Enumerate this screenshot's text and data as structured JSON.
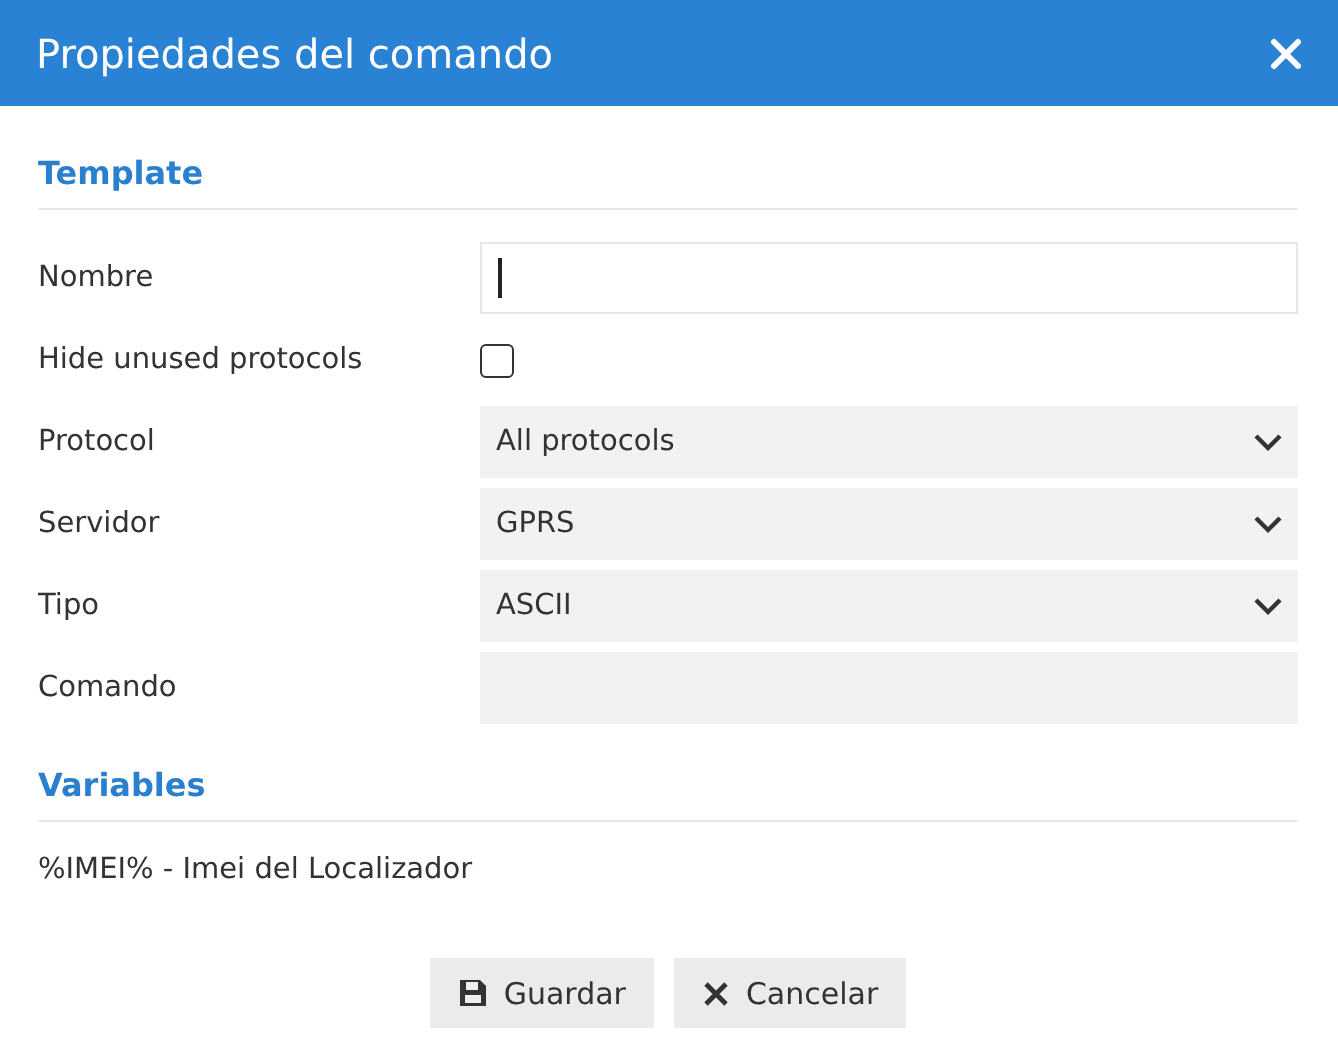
{
  "window": {
    "title": "Propiedades del comando"
  },
  "template": {
    "heading": "Template",
    "fields": [
      {
        "kind": "text",
        "label": "Nombre",
        "focused": true
      },
      {
        "kind": "checkbox",
        "label": "Hide unused protocols",
        "checked": false
      },
      {
        "kind": "select",
        "label": "Protocol",
        "value": "All protocols"
      },
      {
        "kind": "select",
        "label": "Servidor",
        "value": "GPRS"
      },
      {
        "kind": "select",
        "label": "Tipo",
        "value": "ASCII"
      },
      {
        "kind": "input",
        "label": "Comando"
      }
    ]
  },
  "variables": {
    "heading": "Variables",
    "items": [
      "%IMEI% - Imei del Localizador"
    ]
  },
  "buttons": [
    {
      "kind": "save",
      "label": "Guardar"
    },
    {
      "kind": "cancel",
      "label": "Cancelar"
    }
  ]
}
